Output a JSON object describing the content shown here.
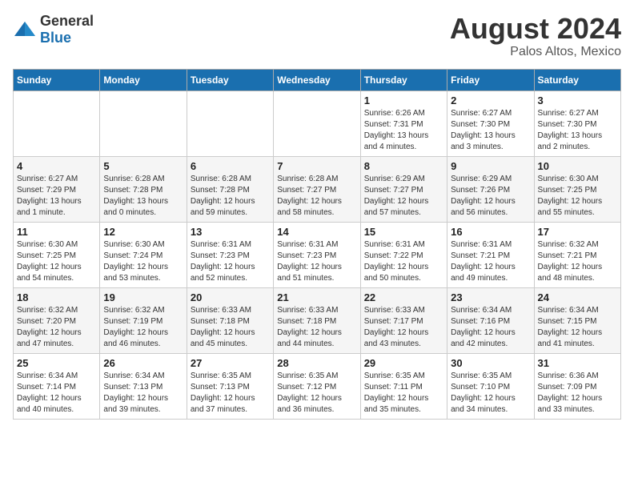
{
  "header": {
    "logo": {
      "general": "General",
      "blue": "Blue"
    },
    "month": "August 2024",
    "location": "Palos Altos, Mexico"
  },
  "weekdays": [
    "Sunday",
    "Monday",
    "Tuesday",
    "Wednesday",
    "Thursday",
    "Friday",
    "Saturday"
  ],
  "weeks": [
    [
      {
        "day": "",
        "info": ""
      },
      {
        "day": "",
        "info": ""
      },
      {
        "day": "",
        "info": ""
      },
      {
        "day": "",
        "info": ""
      },
      {
        "day": "1",
        "info": "Sunrise: 6:26 AM\nSunset: 7:31 PM\nDaylight: 13 hours\nand 4 minutes."
      },
      {
        "day": "2",
        "info": "Sunrise: 6:27 AM\nSunset: 7:30 PM\nDaylight: 13 hours\nand 3 minutes."
      },
      {
        "day": "3",
        "info": "Sunrise: 6:27 AM\nSunset: 7:30 PM\nDaylight: 13 hours\nand 2 minutes."
      }
    ],
    [
      {
        "day": "4",
        "info": "Sunrise: 6:27 AM\nSunset: 7:29 PM\nDaylight: 13 hours\nand 1 minute."
      },
      {
        "day": "5",
        "info": "Sunrise: 6:28 AM\nSunset: 7:28 PM\nDaylight: 13 hours\nand 0 minutes."
      },
      {
        "day": "6",
        "info": "Sunrise: 6:28 AM\nSunset: 7:28 PM\nDaylight: 12 hours\nand 59 minutes."
      },
      {
        "day": "7",
        "info": "Sunrise: 6:28 AM\nSunset: 7:27 PM\nDaylight: 12 hours\nand 58 minutes."
      },
      {
        "day": "8",
        "info": "Sunrise: 6:29 AM\nSunset: 7:27 PM\nDaylight: 12 hours\nand 57 minutes."
      },
      {
        "day": "9",
        "info": "Sunrise: 6:29 AM\nSunset: 7:26 PM\nDaylight: 12 hours\nand 56 minutes."
      },
      {
        "day": "10",
        "info": "Sunrise: 6:30 AM\nSunset: 7:25 PM\nDaylight: 12 hours\nand 55 minutes."
      }
    ],
    [
      {
        "day": "11",
        "info": "Sunrise: 6:30 AM\nSunset: 7:25 PM\nDaylight: 12 hours\nand 54 minutes."
      },
      {
        "day": "12",
        "info": "Sunrise: 6:30 AM\nSunset: 7:24 PM\nDaylight: 12 hours\nand 53 minutes."
      },
      {
        "day": "13",
        "info": "Sunrise: 6:31 AM\nSunset: 7:23 PM\nDaylight: 12 hours\nand 52 minutes."
      },
      {
        "day": "14",
        "info": "Sunrise: 6:31 AM\nSunset: 7:23 PM\nDaylight: 12 hours\nand 51 minutes."
      },
      {
        "day": "15",
        "info": "Sunrise: 6:31 AM\nSunset: 7:22 PM\nDaylight: 12 hours\nand 50 minutes."
      },
      {
        "day": "16",
        "info": "Sunrise: 6:31 AM\nSunset: 7:21 PM\nDaylight: 12 hours\nand 49 minutes."
      },
      {
        "day": "17",
        "info": "Sunrise: 6:32 AM\nSunset: 7:21 PM\nDaylight: 12 hours\nand 48 minutes."
      }
    ],
    [
      {
        "day": "18",
        "info": "Sunrise: 6:32 AM\nSunset: 7:20 PM\nDaylight: 12 hours\nand 47 minutes."
      },
      {
        "day": "19",
        "info": "Sunrise: 6:32 AM\nSunset: 7:19 PM\nDaylight: 12 hours\nand 46 minutes."
      },
      {
        "day": "20",
        "info": "Sunrise: 6:33 AM\nSunset: 7:18 PM\nDaylight: 12 hours\nand 45 minutes."
      },
      {
        "day": "21",
        "info": "Sunrise: 6:33 AM\nSunset: 7:18 PM\nDaylight: 12 hours\nand 44 minutes."
      },
      {
        "day": "22",
        "info": "Sunrise: 6:33 AM\nSunset: 7:17 PM\nDaylight: 12 hours\nand 43 minutes."
      },
      {
        "day": "23",
        "info": "Sunrise: 6:34 AM\nSunset: 7:16 PM\nDaylight: 12 hours\nand 42 minutes."
      },
      {
        "day": "24",
        "info": "Sunrise: 6:34 AM\nSunset: 7:15 PM\nDaylight: 12 hours\nand 41 minutes."
      }
    ],
    [
      {
        "day": "25",
        "info": "Sunrise: 6:34 AM\nSunset: 7:14 PM\nDaylight: 12 hours\nand 40 minutes."
      },
      {
        "day": "26",
        "info": "Sunrise: 6:34 AM\nSunset: 7:13 PM\nDaylight: 12 hours\nand 39 minutes."
      },
      {
        "day": "27",
        "info": "Sunrise: 6:35 AM\nSunset: 7:13 PM\nDaylight: 12 hours\nand 37 minutes."
      },
      {
        "day": "28",
        "info": "Sunrise: 6:35 AM\nSunset: 7:12 PM\nDaylight: 12 hours\nand 36 minutes."
      },
      {
        "day": "29",
        "info": "Sunrise: 6:35 AM\nSunset: 7:11 PM\nDaylight: 12 hours\nand 35 minutes."
      },
      {
        "day": "30",
        "info": "Sunrise: 6:35 AM\nSunset: 7:10 PM\nDaylight: 12 hours\nand 34 minutes."
      },
      {
        "day": "31",
        "info": "Sunrise: 6:36 AM\nSunset: 7:09 PM\nDaylight: 12 hours\nand 33 minutes."
      }
    ]
  ]
}
